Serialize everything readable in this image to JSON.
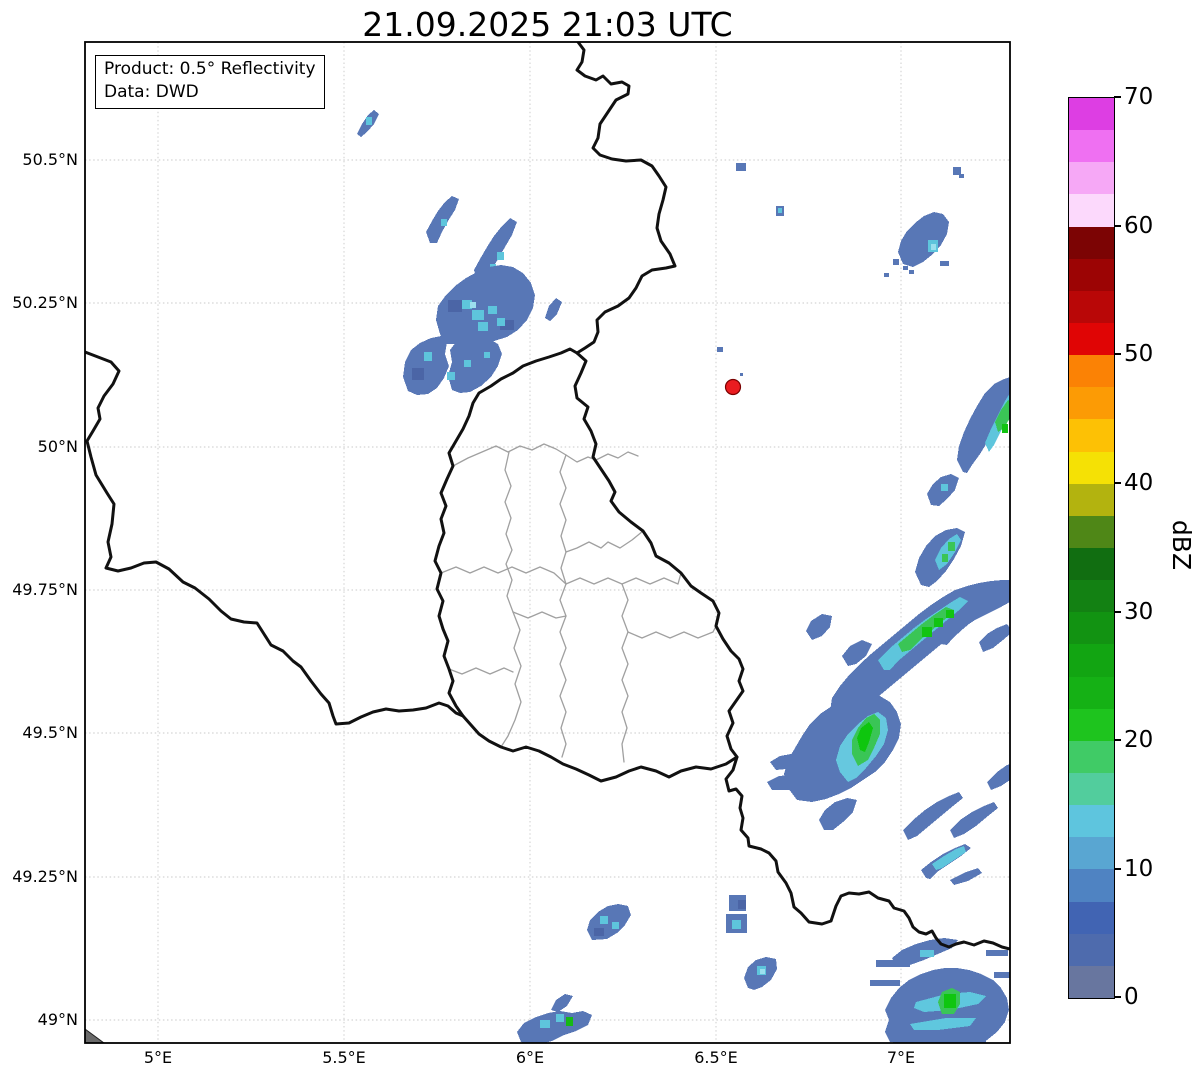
{
  "title": "21.09.2025 21:03 UTC",
  "product_box": {
    "line1": "Product: 0.5° Reflectivity",
    "line2": "Data: DWD"
  },
  "map": {
    "x_tick_labels": [
      "5°E",
      "5.5°E",
      "6°E",
      "6.5°E",
      "7°E"
    ],
    "y_tick_labels": [
      "50.5°N",
      "50.25°N",
      "50°N",
      "49.75°N",
      "49.5°N",
      "49.25°N",
      "49°N"
    ],
    "marker_color": "#ea1c20",
    "radar_palette": {
      "base_blue": "#5877b6",
      "dark_blue": "#4b65a6",
      "cyan": "#5ec5dc",
      "light_cyan": "#9ce0ee",
      "teal": "#52cd9d",
      "green": "#3ac556",
      "bright_green": "#12c412"
    }
  },
  "colorbar": {
    "label": "dBZ",
    "min": 0,
    "max": 70,
    "tick_labels": [
      "70",
      "60",
      "50",
      "40",
      "30",
      "20",
      "10",
      "0"
    ],
    "segments": [
      {
        "range": [
          0,
          2.5
        ],
        "color": "#68769f"
      },
      {
        "range": [
          2.5,
          5
        ],
        "color": "#4e6bad"
      },
      {
        "range": [
          5,
          7.5
        ],
        "color": "#4164b3"
      },
      {
        "range": [
          7.5,
          10
        ],
        "color": "#4f83c2"
      },
      {
        "range": [
          10,
          12.5
        ],
        "color": "#59a6d2"
      },
      {
        "range": [
          12.5,
          15
        ],
        "color": "#5ec5de"
      },
      {
        "range": [
          15,
          17.5
        ],
        "color": "#52cd9d"
      },
      {
        "range": [
          17.5,
          20
        ],
        "color": "#40cb66"
      },
      {
        "range": [
          20,
          22.5
        ],
        "color": "#1ec41e"
      },
      {
        "range": [
          22.5,
          25
        ],
        "color": "#15b115"
      },
      {
        "range": [
          25,
          27.5
        ],
        "color": "#12a512"
      },
      {
        "range": [
          27.5,
          30
        ],
        "color": "#129312"
      },
      {
        "range": [
          30,
          32.5
        ],
        "color": "#138113"
      },
      {
        "range": [
          32.5,
          35
        ],
        "color": "#116e11"
      },
      {
        "range": [
          35,
          37.5
        ],
        "color": "#4f8717"
      },
      {
        "range": [
          37.5,
          40
        ],
        "color": "#b3b30f"
      },
      {
        "range": [
          40,
          42.5
        ],
        "color": "#f5e105"
      },
      {
        "range": [
          42.5,
          45
        ],
        "color": "#fdc105"
      },
      {
        "range": [
          45,
          47.5
        ],
        "color": "#fc9b05"
      },
      {
        "range": [
          47.5,
          50
        ],
        "color": "#fb8205"
      },
      {
        "range": [
          50,
          52.5
        ],
        "color": "#e00505"
      },
      {
        "range": [
          52.5,
          55
        ],
        "color": "#b90707"
      },
      {
        "range": [
          55,
          57.5
        ],
        "color": "#9c0404"
      },
      {
        "range": [
          57.5,
          60
        ],
        "color": "#7c0404"
      },
      {
        "range": [
          60,
          62.5
        ],
        "color": "#fcd9fc"
      },
      {
        "range": [
          62.5,
          65
        ],
        "color": "#f6a8f6"
      },
      {
        "range": [
          65,
          67.5
        ],
        "color": "#ef70f2"
      },
      {
        "range": [
          67.5,
          70
        ],
        "color": "#dd3ee3"
      }
    ]
  }
}
